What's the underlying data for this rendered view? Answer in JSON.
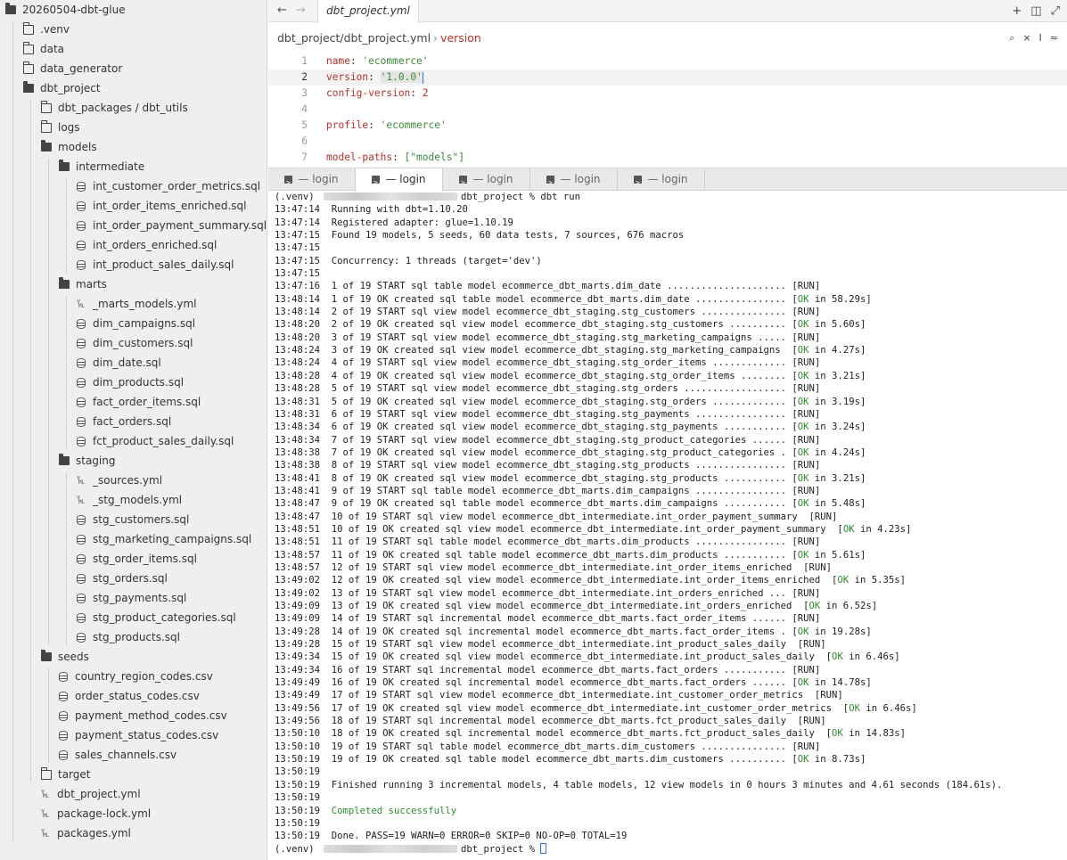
{
  "sidebar": {
    "items": [
      {
        "label": "20260504-dbt-glue",
        "type": "folder-open",
        "depth": 0,
        "dim": false
      },
      {
        "label": ".venv",
        "type": "folder-closed",
        "depth": 1,
        "dim": true
      },
      {
        "label": "data",
        "type": "folder-closed",
        "depth": 1,
        "dim": true
      },
      {
        "label": "data_generator",
        "type": "folder-closed",
        "depth": 1,
        "dim": false
      },
      {
        "label": "dbt_project",
        "type": "folder-open",
        "depth": 1,
        "dim": false
      },
      {
        "label": "dbt_packages / dbt_utils",
        "type": "folder-closed",
        "depth": 2,
        "dim": true
      },
      {
        "label": "logs",
        "type": "folder-closed",
        "depth": 2,
        "dim": true
      },
      {
        "label": "models",
        "type": "folder-open",
        "depth": 2,
        "dim": false
      },
      {
        "label": "intermediate",
        "type": "folder-open",
        "depth": 3,
        "dim": false
      },
      {
        "label": "int_customer_order_metrics.sql",
        "type": "sql",
        "depth": 4,
        "dim": false
      },
      {
        "label": "int_order_items_enriched.sql",
        "type": "sql",
        "depth": 4,
        "dim": false
      },
      {
        "label": "int_order_payment_summary.sql",
        "type": "sql",
        "depth": 4,
        "dim": false
      },
      {
        "label": "int_orders_enriched.sql",
        "type": "sql",
        "depth": 4,
        "dim": false
      },
      {
        "label": "int_product_sales_daily.sql",
        "type": "sql",
        "depth": 4,
        "dim": false
      },
      {
        "label": "marts",
        "type": "folder-open",
        "depth": 3,
        "dim": false
      },
      {
        "label": "_marts_models.yml",
        "type": "yml",
        "depth": 4,
        "dim": false
      },
      {
        "label": "dim_campaigns.sql",
        "type": "sql",
        "depth": 4,
        "dim": false
      },
      {
        "label": "dim_customers.sql",
        "type": "sql",
        "depth": 4,
        "dim": false
      },
      {
        "label": "dim_date.sql",
        "type": "sql",
        "depth": 4,
        "dim": false
      },
      {
        "label": "dim_products.sql",
        "type": "sql",
        "depth": 4,
        "dim": false
      },
      {
        "label": "fact_order_items.sql",
        "type": "sql",
        "depth": 4,
        "dim": false
      },
      {
        "label": "fact_orders.sql",
        "type": "sql",
        "depth": 4,
        "dim": false
      },
      {
        "label": "fct_product_sales_daily.sql",
        "type": "sql",
        "depth": 4,
        "dim": false
      },
      {
        "label": "staging",
        "type": "folder-open",
        "depth": 3,
        "dim": false
      },
      {
        "label": "_sources.yml",
        "type": "yml",
        "depth": 4,
        "dim": false
      },
      {
        "label": "_stg_models.yml",
        "type": "yml",
        "depth": 4,
        "dim": false
      },
      {
        "label": "stg_customers.sql",
        "type": "sql",
        "depth": 4,
        "dim": false
      },
      {
        "label": "stg_marketing_campaigns.sql",
        "type": "sql",
        "depth": 4,
        "dim": false
      },
      {
        "label": "stg_order_items.sql",
        "type": "sql",
        "depth": 4,
        "dim": false
      },
      {
        "label": "stg_orders.sql",
        "type": "sql",
        "depth": 4,
        "dim": false
      },
      {
        "label": "stg_payments.sql",
        "type": "sql",
        "depth": 4,
        "dim": false
      },
      {
        "label": "stg_product_categories.sql",
        "type": "sql",
        "depth": 4,
        "dim": false
      },
      {
        "label": "stg_products.sql",
        "type": "sql",
        "depth": 4,
        "dim": false
      },
      {
        "label": "seeds",
        "type": "folder-open",
        "depth": 2,
        "dim": false
      },
      {
        "label": "country_region_codes.csv",
        "type": "sql",
        "depth": 3,
        "dim": false
      },
      {
        "label": "order_status_codes.csv",
        "type": "sql",
        "depth": 3,
        "dim": false
      },
      {
        "label": "payment_method_codes.csv",
        "type": "sql",
        "depth": 3,
        "dim": false
      },
      {
        "label": "payment_status_codes.csv",
        "type": "sql",
        "depth": 3,
        "dim": false
      },
      {
        "label": "sales_channels.csv",
        "type": "sql",
        "depth": 3,
        "dim": false
      },
      {
        "label": "target",
        "type": "folder-closed",
        "depth": 2,
        "dim": true
      },
      {
        "label": "dbt_project.yml",
        "type": "yml",
        "depth": 2,
        "dim": false
      },
      {
        "label": "package-lock.yml",
        "type": "yml",
        "depth": 2,
        "dim": false
      },
      {
        "label": "packages.yml",
        "type": "yml",
        "depth": 2,
        "dim": false
      }
    ]
  },
  "editor": {
    "nav_back": "←",
    "nav_forward": "→",
    "tab_label": "dbt_project.yml",
    "actions": {
      "new": "+",
      "split": "◫",
      "expand": "⤢"
    },
    "breadcrumb_path": "dbt_project/dbt_project.yml",
    "breadcrumb_sep": "›",
    "breadcrumb_symbol": "version",
    "tools": {
      "search": "⌕",
      "tool2": "⨯",
      "cursor": "I",
      "settings": "≈"
    },
    "lines": [
      {
        "num": "1",
        "key": "name",
        "value": "'ecommerce'",
        "vtype": "s"
      },
      {
        "num": "2",
        "key": "version",
        "value": "'1.0.0'",
        "vtype": "s"
      },
      {
        "num": "3",
        "key": "config-version",
        "value": "2",
        "vtype": "n"
      },
      {
        "num": "4",
        "key": "",
        "value": "",
        "vtype": ""
      },
      {
        "num": "5",
        "key": "profile",
        "value": "'ecommerce'",
        "vtype": "s"
      },
      {
        "num": "6",
        "key": "",
        "value": "",
        "vtype": ""
      },
      {
        "num": "7",
        "key": "model-paths",
        "value": "[\"models\"]",
        "vtype": "arr"
      }
    ],
    "active_line": 1
  },
  "terminal_tabs": [
    "— login",
    "— login",
    "— login",
    "— login",
    "— login"
  ],
  "terminal_active_tab": 1,
  "terminal": {
    "prompt_prefix": "(.venv)",
    "prompt_suffix": "dbt_project % dbt run",
    "prompt_suffix_end": "dbt_project %",
    "lines": [
      "13:47:14  Running with dbt=1.10.20",
      "13:47:14  Registered adapter: glue=1.10.19",
      "13:47:15  Found 19 models, 5 seeds, 60 data tests, 7 sources, 676 macros",
      "13:47:15",
      "13:47:15  Concurrency: 1 threads (target='dev')",
      "13:47:15",
      "13:47:16  1 of 19 START sql table model ecommerce_dbt_marts.dim_date ..................... [RUN]",
      "13:48:14  1 of 19 OK created sql table model ecommerce_dbt_marts.dim_date ................ [OK in 58.29s]",
      "13:48:14  2 of 19 START sql view model ecommerce_dbt_staging.stg_customers ............... [RUN]",
      "13:48:20  2 of 19 OK created sql view model ecommerce_dbt_staging.stg_customers .......... [OK in 5.60s]",
      "13:48:20  3 of 19 START sql view model ecommerce_dbt_staging.stg_marketing_campaigns ..... [RUN]",
      "13:48:24  3 of 19 OK created sql view model ecommerce_dbt_staging.stg_marketing_campaigns  [OK in 4.27s]",
      "13:48:24  4 of 19 START sql view model ecommerce_dbt_staging.stg_order_items ............. [RUN]",
      "13:48:28  4 of 19 OK created sql view model ecommerce_dbt_staging.stg_order_items ........ [OK in 3.21s]",
      "13:48:28  5 of 19 START sql view model ecommerce_dbt_staging.stg_orders .................. [RUN]",
      "13:48:31  5 of 19 OK created sql view model ecommerce_dbt_staging.stg_orders ............. [OK in 3.19s]",
      "13:48:31  6 of 19 START sql view model ecommerce_dbt_staging.stg_payments ................ [RUN]",
      "13:48:34  6 of 19 OK created sql view model ecommerce_dbt_staging.stg_payments ........... [OK in 3.24s]",
      "13:48:34  7 of 19 START sql view model ecommerce_dbt_staging.stg_product_categories ...... [RUN]",
      "13:48:38  7 of 19 OK created sql view model ecommerce_dbt_staging.stg_product_categories . [OK in 4.24s]",
      "13:48:38  8 of 19 START sql view model ecommerce_dbt_staging.stg_products ................ [RUN]",
      "13:48:41  8 of 19 OK created sql view model ecommerce_dbt_staging.stg_products ........... [OK in 3.21s]",
      "13:48:41  9 of 19 START sql table model ecommerce_dbt_marts.dim_campaigns ................ [RUN]",
      "13:48:47  9 of 19 OK created sql table model ecommerce_dbt_marts.dim_campaigns ........... [OK in 5.48s]",
      "13:48:47  10 of 19 START sql view model ecommerce_dbt_intermediate.int_order_payment_summary  [RUN]",
      "13:48:51  10 of 19 OK created sql view model ecommerce_dbt_intermediate.int_order_payment_summary  [OK in 4.23s]",
      "13:48:51  11 of 19 START sql table model ecommerce_dbt_marts.dim_products ................ [RUN]",
      "13:48:57  11 of 19 OK created sql table model ecommerce_dbt_marts.dim_products ........... [OK in 5.61s]",
      "13:48:57  12 of 19 START sql view model ecommerce_dbt_intermediate.int_order_items_enriched  [RUN]",
      "13:49:02  12 of 19 OK created sql view model ecommerce_dbt_intermediate.int_order_items_enriched  [OK in 5.35s]",
      "13:49:02  13 of 19 START sql view model ecommerce_dbt_intermediate.int_orders_enriched ... [RUN]",
      "13:49:09  13 of 19 OK created sql view model ecommerce_dbt_intermediate.int_orders_enriched  [OK in 6.52s]",
      "13:49:09  14 of 19 START sql incremental model ecommerce_dbt_marts.fact_order_items ...... [RUN]",
      "13:49:28  14 of 19 OK created sql incremental model ecommerce_dbt_marts.fact_order_items . [OK in 19.28s]",
      "13:49:28  15 of 19 START sql view model ecommerce_dbt_intermediate.int_product_sales_daily  [RUN]",
      "13:49:34  15 of 19 OK created sql view model ecommerce_dbt_intermediate.int_product_sales_daily  [OK in 6.46s]",
      "13:49:34  16 of 19 START sql incremental model ecommerce_dbt_marts.fact_orders ........... [RUN]",
      "13:49:49  16 of 19 OK created sql incremental model ecommerce_dbt_marts.fact_orders ...... [OK in 14.78s]",
      "13:49:49  17 of 19 START sql view model ecommerce_dbt_intermediate.int_customer_order_metrics  [RUN]",
      "13:49:56  17 of 19 OK created sql view model ecommerce_dbt_intermediate.int_customer_order_metrics  [OK in 6.46s]",
      "13:49:56  18 of 19 START sql incremental model ecommerce_dbt_marts.fct_product_sales_daily  [RUN]",
      "13:50:10  18 of 19 OK created sql incremental model ecommerce_dbt_marts.fct_product_sales_daily  [OK in 14.83s]",
      "13:50:10  19 of 19 START sql table model ecommerce_dbt_marts.dim_customers ............... [RUN]",
      "13:50:19  19 of 19 OK created sql table model ecommerce_dbt_marts.dim_customers .......... [OK in 8.73s]",
      "13:50:19",
      "13:50:19  Finished running 3 incremental models, 4 table models, 12 view models in 0 hours 3 minutes and 4.61 seconds (184.61s).",
      "13:50:19",
      "13:50:19  Completed successfully",
      "13:50:19",
      "13:50:19  Done. PASS=19 WARN=0 ERROR=0 SKIP=0 NO-OP=0 TOTAL=19"
    ]
  }
}
